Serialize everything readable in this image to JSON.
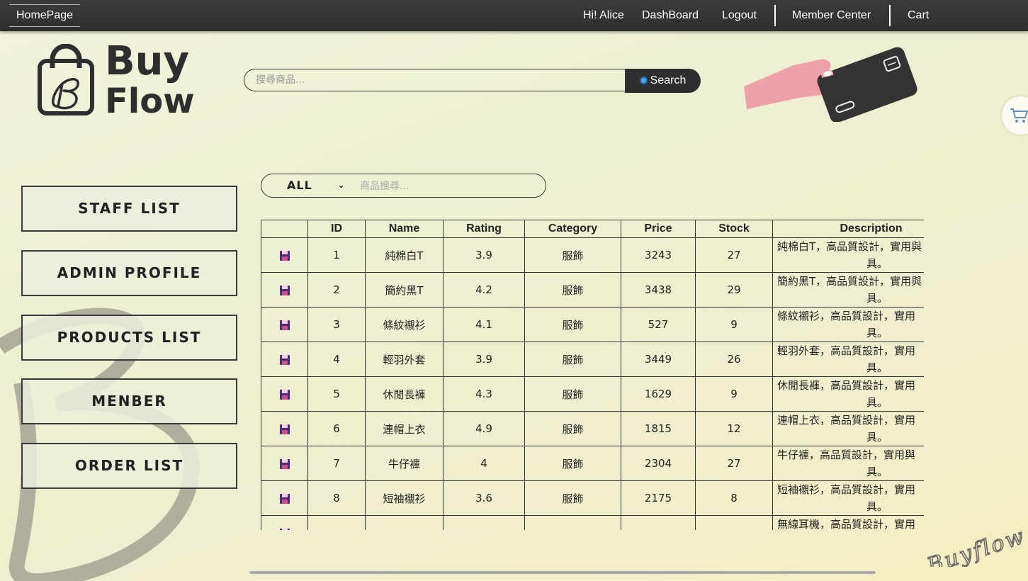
{
  "nav": {
    "home": "HomePage",
    "greeting": "Hi! Alice",
    "dashboard": "DashBoard",
    "logout": "Logout",
    "member_center": "Member Center",
    "cart": "Cart"
  },
  "logo": {
    "line1": "Buy",
    "line2": "Flow"
  },
  "search": {
    "placeholder": "搜尋商品...",
    "button": "Search"
  },
  "sidebar": {
    "items": [
      {
        "label": "STAFF LIST"
      },
      {
        "label": "ADMIN PROFILE"
      },
      {
        "label": "PRODUCTS LIST"
      },
      {
        "label": "MENBER"
      },
      {
        "label": "ORDER LIST"
      }
    ]
  },
  "filter": {
    "selected": "ALL",
    "placeholder": "商品搜尋..."
  },
  "table": {
    "headers": [
      "",
      "ID",
      "Name",
      "Rating",
      "Category",
      "Price",
      "Stock",
      "Description"
    ],
    "rows": [
      {
        "id": "1",
        "name": "純棉白T",
        "rating": "3.9",
        "category": "服飾",
        "price": "3243",
        "stock": "27",
        "desc1": "純棉白T，高品質設計，實用與",
        "desc2": "具。"
      },
      {
        "id": "2",
        "name": "簡約黑T",
        "rating": "4.2",
        "category": "服飾",
        "price": "3438",
        "stock": "29",
        "desc1": "簡約黑T，高品質設計，實用與",
        "desc2": "具。"
      },
      {
        "id": "3",
        "name": "條紋襯衫",
        "rating": "4.1",
        "category": "服飾",
        "price": "527",
        "stock": "9",
        "desc1": "條紋襯衫，高品質設計，實用",
        "desc2": "具。"
      },
      {
        "id": "4",
        "name": "輕羽外套",
        "rating": "3.9",
        "category": "服飾",
        "price": "3449",
        "stock": "26",
        "desc1": "輕羽外套，高品質設計，實用",
        "desc2": "具。"
      },
      {
        "id": "5",
        "name": "休閒長褲",
        "rating": "4.3",
        "category": "服飾",
        "price": "1629",
        "stock": "9",
        "desc1": "休閒長褲，高品質設計，實用",
        "desc2": "具。"
      },
      {
        "id": "6",
        "name": "連帽上衣",
        "rating": "4.9",
        "category": "服飾",
        "price": "1815",
        "stock": "12",
        "desc1": "連帽上衣，高品質設計，實用",
        "desc2": "具。"
      },
      {
        "id": "7",
        "name": "牛仔褲",
        "rating": "4",
        "category": "服飾",
        "price": "2304",
        "stock": "27",
        "desc1": " 牛仔褲，高品質設計，實用與",
        "desc2": "具。"
      },
      {
        "id": "8",
        "name": "短袖襯衫",
        "rating": "3.6",
        "category": "服飾",
        "price": "2175",
        "stock": "8",
        "desc1": "短袖襯衫，高品質設計，實用",
        "desc2": "具。"
      },
      {
        "id": "",
        "name": "",
        "rating": "",
        "category": "",
        "price": "",
        "stock": "",
        "desc1": "無線耳機，高品質設計，實用",
        "desc2": ""
      }
    ]
  },
  "signature": "Buyflow",
  "colors": {
    "nav_bg": "#2e2e2e",
    "accent_pink": "#f0a0a8",
    "card_dark": "#333333",
    "save_icon": "#4a2a7a"
  }
}
